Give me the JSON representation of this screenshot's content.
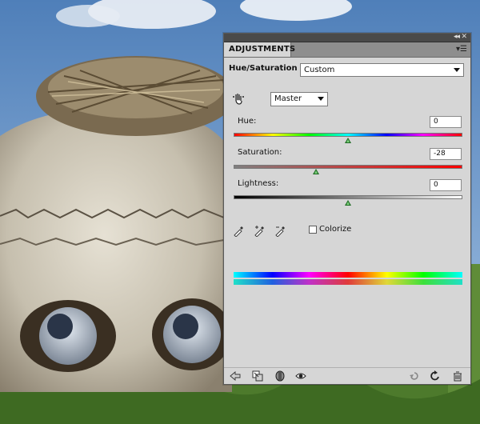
{
  "panel": {
    "tab_label": "ADJUSTMENTS",
    "adjustment_name": "Hue/Saturation",
    "preset_value": "Custom",
    "channel_value": "Master",
    "hue": {
      "label": "Hue:",
      "value": "0",
      "position": 0.5
    },
    "saturation": {
      "label": "Saturation:",
      "value": "-28",
      "position": 0.36
    },
    "lightness": {
      "label": "Lightness:",
      "value": "0",
      "position": 0.5
    },
    "colorize_label": "Colorize",
    "colorize_checked": false
  },
  "icons": {
    "titlebar": [
      "collapse-icon",
      "close-icon"
    ],
    "panel_menu": "panel-menu-icon",
    "targeted_adjustment": "hand-adjust-icon",
    "eyedroppers": [
      "eyedropper-icon",
      "eyedropper-plus-icon",
      "eyedropper-minus-icon"
    ],
    "bottom": [
      "back-arrow-icon",
      "clip-to-layer-icon",
      "layer-mask-icon",
      "visibility-eye-icon",
      "previous-state-icon",
      "reset-icon",
      "trash-icon"
    ]
  },
  "colors": {
    "panel_bg": "#d6d6d6",
    "titlebar_bg": "#4a4a4a",
    "slider_thumb": "#1d6b21"
  }
}
